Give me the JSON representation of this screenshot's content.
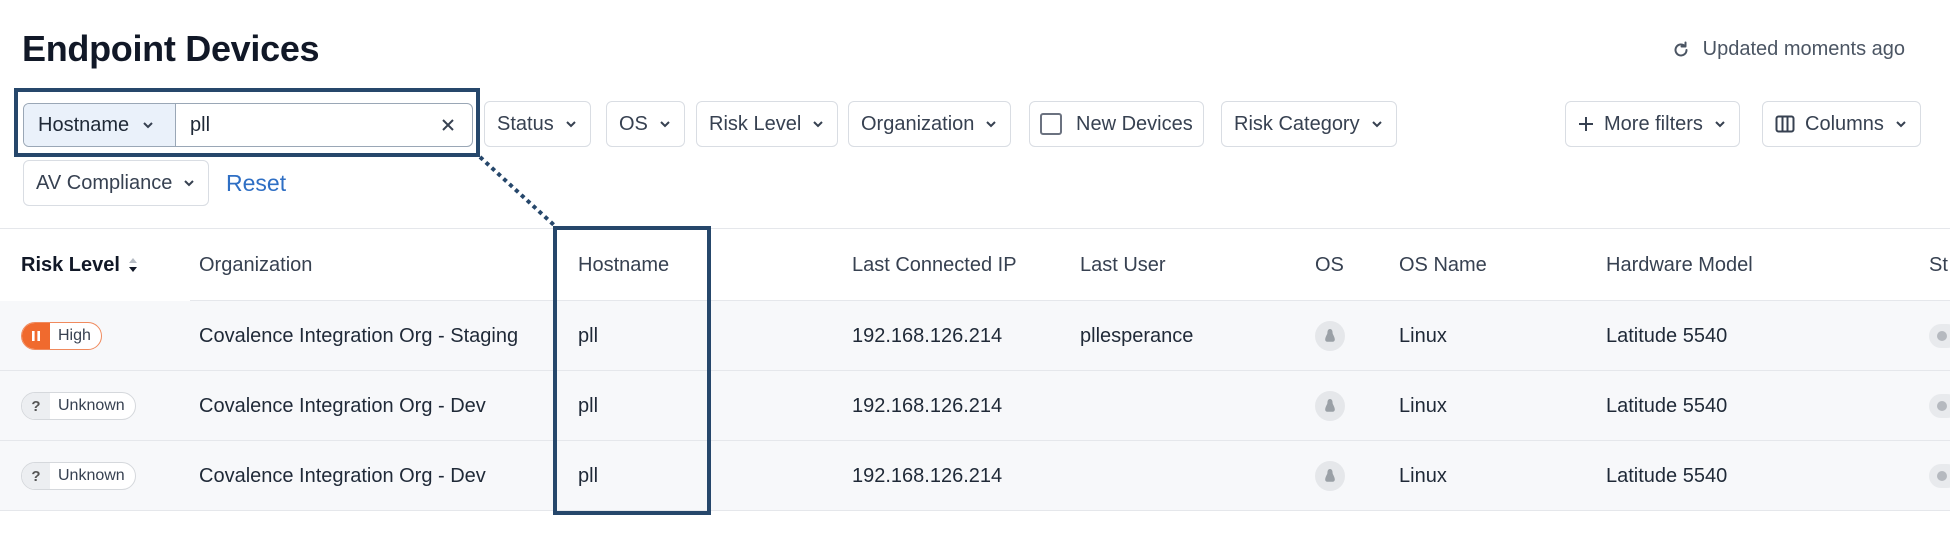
{
  "page": {
    "title": "Endpoint Devices",
    "updated_text": "Updated moments ago"
  },
  "filters": {
    "search_field_label": "Hostname",
    "search_value": "pll",
    "status_label": "Status",
    "os_label": "OS",
    "risk_level_label": "Risk Level",
    "organization_label": "Organization",
    "new_devices_label": "New Devices",
    "risk_category_label": "Risk Category",
    "more_filters_label": "More filters",
    "columns_label": "Columns",
    "av_compliance_label": "AV Compliance",
    "reset_label": "Reset"
  },
  "table": {
    "columns": {
      "risk_level": "Risk Level",
      "organization": "Organization",
      "hostname": "Hostname",
      "last_connected_ip": "Last Connected IP",
      "last_user": "Last User",
      "os": "OS",
      "os_name": "OS Name",
      "hardware_model": "Hardware Model",
      "status": "St"
    },
    "rows": [
      {
        "risk": "High",
        "risk_icon": "pause-icon",
        "organization": "Covalence Integration Org - Staging",
        "hostname": "pll",
        "ip": "192.168.126.214",
        "last_user": "pllesperance",
        "os_icon": "linux-icon",
        "os_name": "Linux",
        "hardware_model": "Latitude 5540"
      },
      {
        "risk": "Unknown",
        "risk_icon": "question-icon",
        "organization": "Covalence Integration Org - Dev",
        "hostname": "pll",
        "ip": "192.168.126.214",
        "last_user": "",
        "os_icon": "linux-icon",
        "os_name": "Linux",
        "hardware_model": "Latitude 5540"
      },
      {
        "risk": "Unknown",
        "risk_icon": "question-icon",
        "organization": "Covalence Integration Org - Dev",
        "hostname": "pll",
        "ip": "192.168.126.214",
        "last_user": "",
        "os_icon": "linux-icon",
        "os_name": "Linux",
        "hardware_model": "Latitude 5540"
      }
    ],
    "unknown_glyph": "?"
  },
  "colors": {
    "highlight": "#26476b",
    "high_risk": "#f06a2e",
    "link": "#2f6fc4"
  }
}
